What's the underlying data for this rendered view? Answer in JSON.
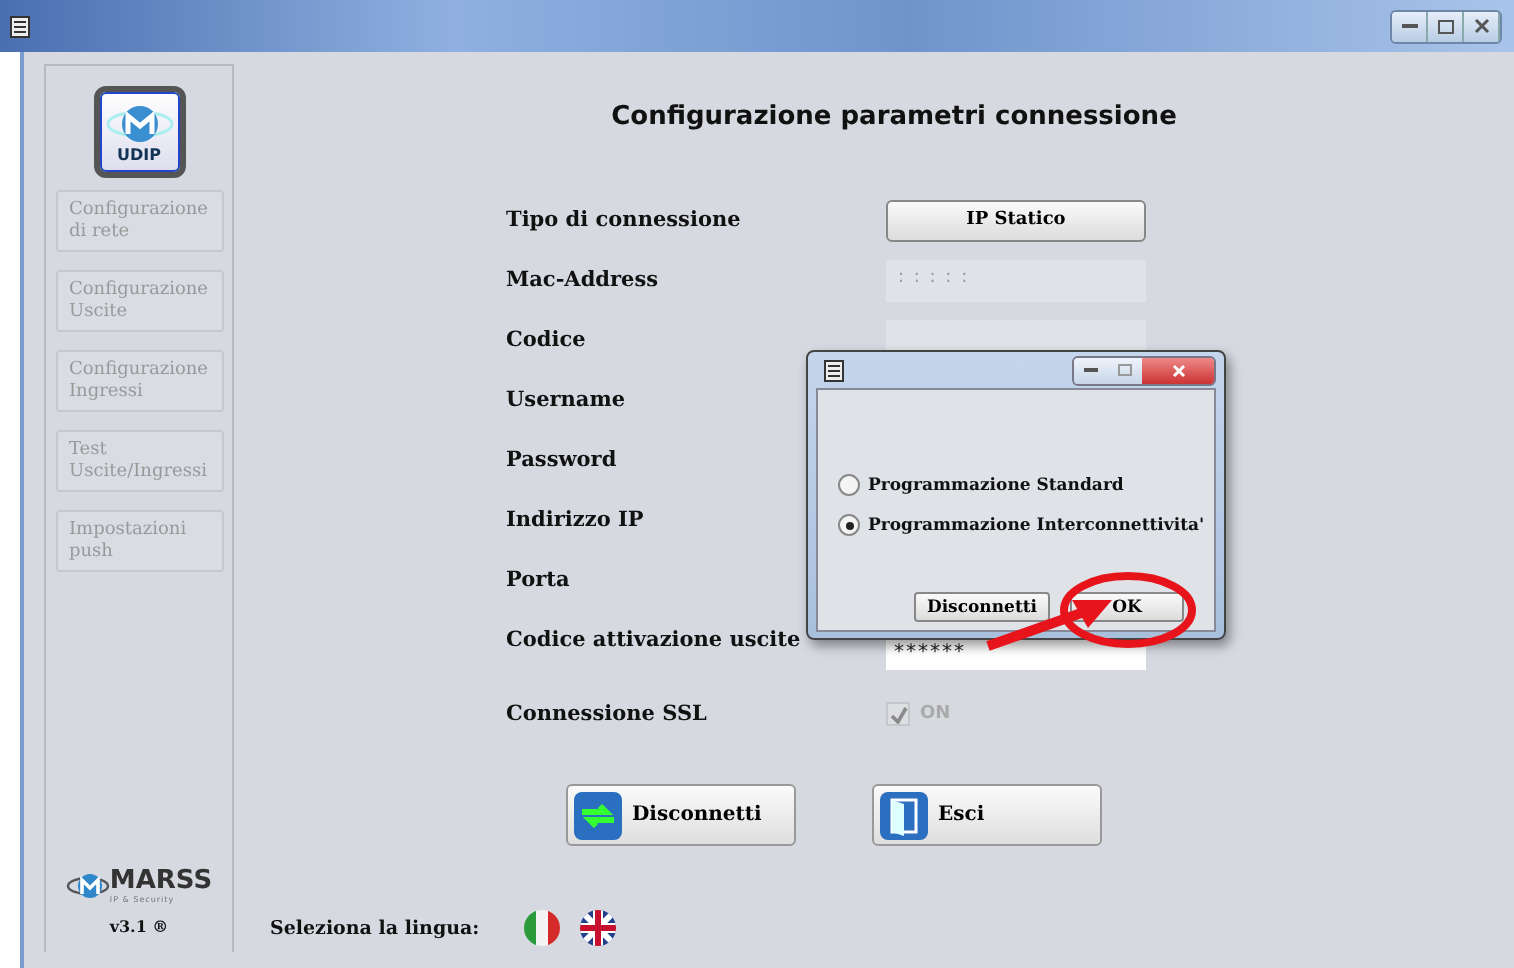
{
  "sidebar": {
    "logo": "UDIP",
    "items": [
      {
        "label": "Configurazione di rete",
        "disabled": true
      },
      {
        "label": "Configurazione Uscite",
        "disabled": true
      },
      {
        "label": "Configurazione Ingressi",
        "disabled": true
      },
      {
        "label": "Test Uscite/Ingressi",
        "disabled": true
      },
      {
        "label": "Impostazioni push",
        "disabled": true
      }
    ],
    "brand": "MARSS",
    "tagline": "IP & Security",
    "version": "v3.1 ®"
  },
  "main": {
    "title": "Configurazione parametri connessione",
    "rows": [
      {
        "label": "Tipo di connessione",
        "kind": "button",
        "value": "IP Statico"
      },
      {
        "label": "Mac-Address",
        "kind": "field",
        "placeholder": ": : : : :"
      },
      {
        "label": "Codice",
        "kind": "field"
      },
      {
        "label": "Username",
        "kind": "covered"
      },
      {
        "label": "Password",
        "kind": "covered"
      },
      {
        "label": "Indirizzo IP",
        "kind": "covered"
      },
      {
        "label": "Porta",
        "kind": "covered"
      },
      {
        "label": "Codice attivazione uscite",
        "kind": "password",
        "value": "******"
      },
      {
        "label": "Connessione SSL",
        "kind": "checkbox",
        "value": "ON",
        "checked": true,
        "disabled": true
      }
    ],
    "actions": [
      {
        "label": "Disconnetti",
        "kind": "connect"
      },
      {
        "label": "Esci",
        "kind": "exit"
      }
    ],
    "language": {
      "label": "Seleziona la lingua:",
      "flags": [
        {
          "kind": "italy"
        },
        {
          "kind": "uk"
        }
      ]
    }
  },
  "dialog": {
    "options": [
      {
        "label": "Programmazione Standard",
        "selected": false
      },
      {
        "label": "Programmazione Interconnettivita'",
        "selected": true
      }
    ],
    "buttons": [
      "Disconnetti",
      "OK"
    ]
  },
  "annotations": [
    {
      "kind": "ellipse"
    },
    {
      "kind": "arrow"
    }
  ]
}
